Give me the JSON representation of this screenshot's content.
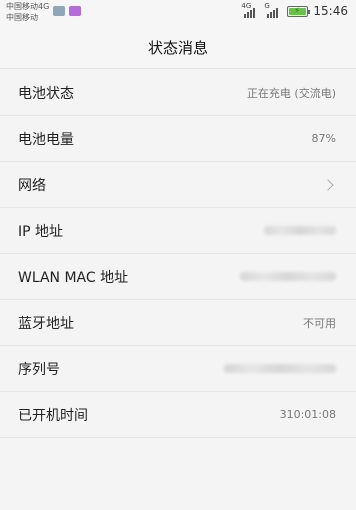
{
  "status_bar": {
    "carrier_1": "中国移动4G",
    "carrier_2": "中国移动",
    "network_tag_1": "4G",
    "network_tag_2": "G",
    "time": "15:46",
    "battery_level": 0.87,
    "battery_charging": true,
    "icons": [
      "gallery-icon",
      "message-icon",
      "signal-icon",
      "battery-icon"
    ]
  },
  "header": {
    "title": "状态消息"
  },
  "rows": [
    {
      "label": "电池状态",
      "value": "正在充电 (交流电)"
    },
    {
      "label": "电池电量",
      "value": "87%"
    },
    {
      "label": "网络",
      "value": ""
    },
    {
      "label": "IP 地址",
      "value": ""
    },
    {
      "label": "WLAN MAC 地址",
      "value": ""
    },
    {
      "label": "蓝牙地址",
      "value": "不可用"
    },
    {
      "label": "序列号",
      "value": ""
    },
    {
      "label": "已开机时间",
      "value": "310:01:08"
    }
  ],
  "colors": {
    "background": "#f4f4f4",
    "divider": "#e6e6e6",
    "battery_fill": "#6ac14a",
    "message_icon": "#b36bd9"
  }
}
